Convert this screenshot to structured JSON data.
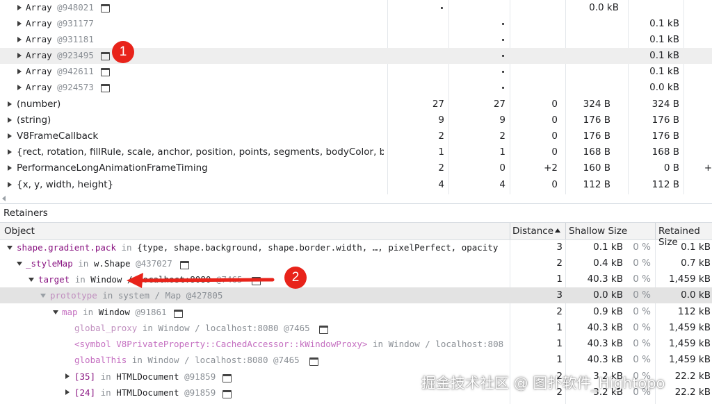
{
  "top_rows": [
    {
      "type": "Array",
      "id": "@948021",
      "dot_col": 1,
      "retained": "0.0 kB",
      "retained_col": "shallow"
    },
    {
      "type": "Array",
      "id": "@931177",
      "dot_col": 2,
      "retained": "0.1 kB",
      "retained_col": "retained"
    },
    {
      "type": "Array",
      "id": "@931181",
      "dot_col": 2,
      "retained": "0.1 kB",
      "retained_col": "retained"
    },
    {
      "type": "Array",
      "id": "@923495",
      "dot_col": 2,
      "retained": "0.1 kB",
      "retained_col": "retained"
    },
    {
      "type": "Array",
      "id": "@942611",
      "dot_col": 2,
      "retained": "0.1 kB",
      "retained_col": "retained"
    },
    {
      "type": "Array",
      "id": "@924573",
      "dot_col": 2,
      "retained": "0.0 kB",
      "retained_col": "retained"
    }
  ],
  "summary_rows": [
    {
      "name": "(number)",
      "c1": "27",
      "c2": "27",
      "c3": "0",
      "c4": "324 B",
      "c5": "324 B",
      "c6": ""
    },
    {
      "name": "(string)",
      "c1": "9",
      "c2": "9",
      "c3": "0",
      "c4": "176 B",
      "c5": "176 B",
      "c6": ""
    },
    {
      "name": "V8FrameCallback",
      "c1": "2",
      "c2": "2",
      "c3": "0",
      "c4": "176 B",
      "c5": "176 B",
      "c6": ""
    },
    {
      "name": "{rect, rotation, fillRule, scale, anchor, position, points, segments, bodyColor, b…",
      "c1": "1",
      "c2": "1",
      "c3": "0",
      "c4": "168 B",
      "c5": "168 B",
      "c6": ""
    },
    {
      "name": "PerformanceLongAnimationFrameTiming",
      "c1": "2",
      "c2": "0",
      "c3": "+2",
      "c4": "160 B",
      "c5": "0 B",
      "c6": "+"
    },
    {
      "name": "{x, y, width, height}",
      "c1": "4",
      "c2": "4",
      "c3": "0",
      "c4": "112 B",
      "c5": "112 B",
      "c6": ""
    }
  ],
  "retainers": {
    "title": "Retainers",
    "headers": {
      "object": "Object",
      "distance": "Distance",
      "shallow": "Shallow Size",
      "retained": "Retained Size"
    },
    "rows": [
      {
        "key": "shape.gradient.pack",
        "in": "in",
        "ctx": "{type, shape.background, shape.border.width, …, pixelPerfect, opacity",
        "id": "",
        "distance": "3",
        "shallow": "0.1 kB",
        "shallow_pct": "0 %",
        "retained": "0.1 kB"
      },
      {
        "key": "_styleMap",
        "in": "in",
        "ctx": "w.Shape",
        "id": "@437027",
        "distance": "2",
        "shallow": "0.4 kB",
        "shallow_pct": "0 %",
        "retained": "0.7 kB"
      },
      {
        "key": "target",
        "in": "in",
        "ctx": "Window",
        "ctx_tail": "/ localhost:8080",
        "id": "@7465",
        "distance": "1",
        "shallow": "40.3 kB",
        "shallow_pct": "0 %",
        "retained": "1,459 kB"
      },
      {
        "key": "prototype",
        "in": "in",
        "ctx": "system / Map",
        "id": "@427805",
        "distance": "3",
        "shallow": "0.0 kB",
        "shallow_pct": "0 %",
        "retained": "0.0 kB"
      },
      {
        "key": "map",
        "in": "in",
        "ctx": "Window",
        "id": "@91861",
        "distance": "2",
        "shallow": "0.9 kB",
        "shallow_pct": "0 %",
        "retained": "112 kB"
      },
      {
        "key": "global_proxy",
        "in": "in",
        "ctx": "Window / localhost:8080",
        "id": "@7465",
        "distance": "1",
        "shallow": "40.3 kB",
        "shallow_pct": "0 %",
        "retained": "1,459 kB"
      },
      {
        "key": "<symbol V8PrivateProperty::CachedAccessor::kWindowProxy>",
        "in": "in",
        "ctx": "Window / localhost:808",
        "id": "",
        "distance": "1",
        "shallow": "40.3 kB",
        "shallow_pct": "0 %",
        "retained": "1,459 kB"
      },
      {
        "key": "globalThis",
        "in": "in",
        "ctx": "Window / localhost:8080",
        "id": "@7465",
        "distance": "1",
        "shallow": "40.3 kB",
        "shallow_pct": "0 %",
        "retained": "1,459 kB"
      },
      {
        "key": "[35]",
        "in": "in",
        "ctx": "HTMLDocument",
        "id": "@91859",
        "distance": "2",
        "shallow": "3.2 kB",
        "shallow_pct": "0 %",
        "retained": "22.2 kB"
      },
      {
        "key": "[24]",
        "in": "in",
        "ctx": "HTMLDocument",
        "id": "@91859",
        "distance": "2",
        "shallow": "3.2 kB",
        "shallow_pct": "0 %",
        "retained": "22.2 kB"
      }
    ]
  },
  "annotations": {
    "badge1": "1",
    "badge2": "2"
  },
  "watermark": "掘金技术社区 @ 图扑软件_Hightopo",
  "colors": {
    "badge": "#e8231a",
    "arrow": "#e8231a",
    "key_purple": "#881280",
    "selected_row": "#eeeeee"
  }
}
